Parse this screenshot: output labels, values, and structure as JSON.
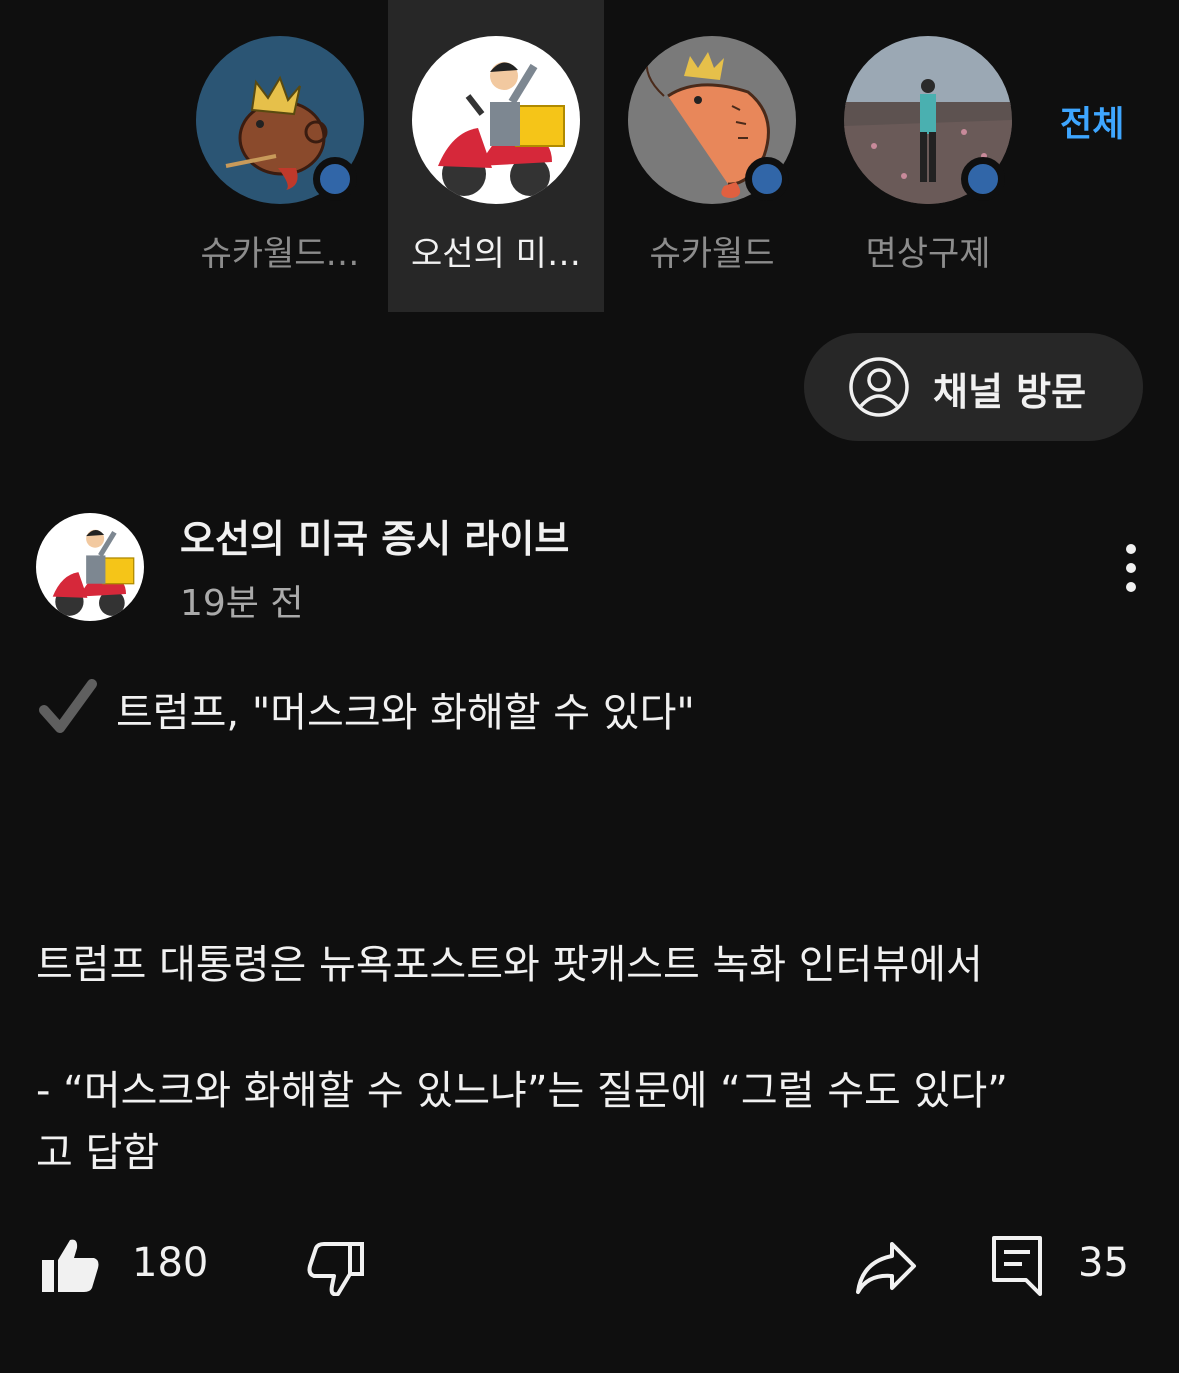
{
  "channels": [
    {
      "name": "슈카월드…",
      "avatar_icon": "prawn-crown-blue-avatar",
      "live_dot": true,
      "selected": false
    },
    {
      "name": "오선의 미…",
      "avatar_icon": "scooter-reporter-avatar",
      "live_dot": false,
      "selected": true
    },
    {
      "name": "슈카월드",
      "avatar_icon": "shrimp-crown-gray-avatar",
      "live_dot": true,
      "selected": false
    },
    {
      "name": "면상구제",
      "avatar_icon": "person-field-photo-avatar",
      "live_dot": true,
      "selected": false
    }
  ],
  "all_link": "전체",
  "visit_button": {
    "label": "채널 방문",
    "icon": "person-circle-icon"
  },
  "post": {
    "channel_name": "오선의 미국 증시 라이브",
    "time": "19분 전",
    "headline_icon": "check-mark-icon",
    "headline": "트럼프, \"머스크와 화해할 수 있다\"",
    "para1": "트럼프 대통령은 뉴욕포스트와 팟캐스트 녹화 인터뷰에서",
    "para2_line1": "- “머스크와 화해할 수 있느냐”는 질문에 “그럴 수도 있다”",
    "para2_line2": "고 답함"
  },
  "actions": {
    "like_count": "180",
    "comment_count": "35",
    "icons": [
      "thumbs-up-icon",
      "thumbs-down-icon",
      "share-icon",
      "comment-icon"
    ]
  },
  "colors": {
    "background": "#0f0f0f",
    "accent_link": "#3ea6ff",
    "live_dot": "#3166a8",
    "chip": "#272727"
  }
}
